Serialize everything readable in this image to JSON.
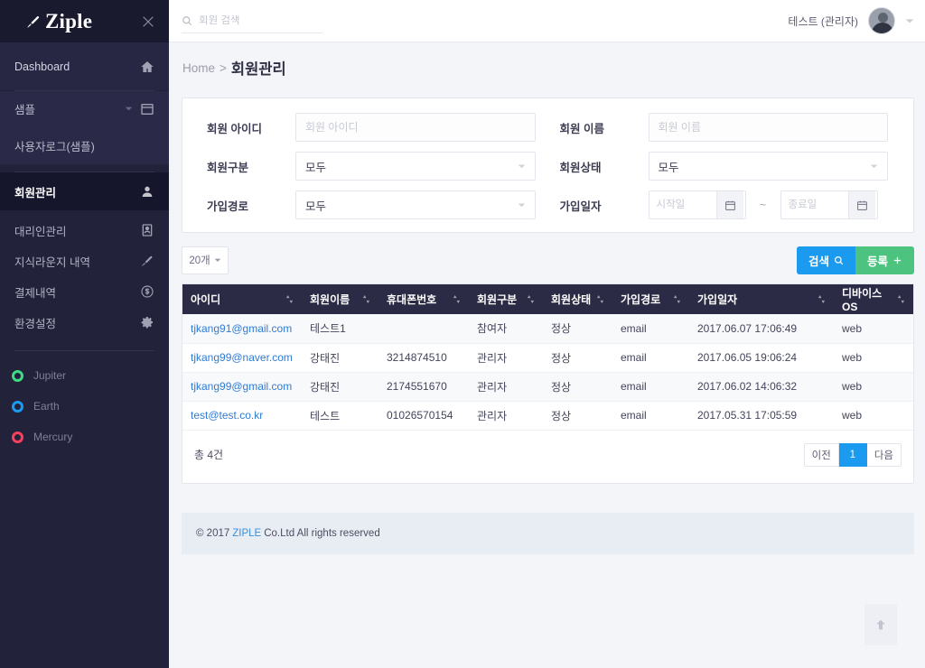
{
  "brand": {
    "name": "Ziple",
    "logo_icon": "pen-nib-icon",
    "close_icon": "close-icon"
  },
  "sidebar": {
    "items": [
      {
        "label": "Dashboard",
        "icon": "home-icon"
      },
      {
        "label": "샘플",
        "icon": "window-icon"
      },
      {
        "label": "사용자로그(샘플)",
        "icon": ""
      },
      {
        "label": "회원관리",
        "icon": "user-icon"
      },
      {
        "label": "대리인관리",
        "icon": "id-card-icon"
      },
      {
        "label": "지식라운지 내역",
        "icon": "pen-icon"
      },
      {
        "label": "결제내역",
        "icon": "dollar-icon"
      },
      {
        "label": "환경설정",
        "icon": "gear-icon"
      }
    ],
    "planets": [
      {
        "label": "Jupiter",
        "color": "#3ddc84"
      },
      {
        "label": "Earth",
        "color": "#1a9bf0"
      },
      {
        "label": "Mercury",
        "color": "#f9405c"
      }
    ]
  },
  "topbar": {
    "search_placeholder": "회원 검색",
    "search_value": "",
    "search_icon": "search-icon",
    "user_name": "테스트 (관리자)",
    "avatar_icon": "avatar",
    "caret_icon": "chevron-down-icon"
  },
  "breadcrumb": {
    "home": "Home",
    "separator": ">",
    "current": "회원관리"
  },
  "search_form": {
    "member_id": {
      "label": "회원 아이디",
      "placeholder": "회원 아이디",
      "value": ""
    },
    "member_name": {
      "label": "회원 이름",
      "placeholder": "회원 이름",
      "value": ""
    },
    "member_type": {
      "label": "회원구분",
      "value": "모두"
    },
    "member_state": {
      "label": "회원상태",
      "value": "모두"
    },
    "join_route": {
      "label": "가입경로",
      "value": "모두"
    },
    "join_date": {
      "label": "가입일자",
      "start_placeholder": "시작일",
      "start_value": "",
      "end_placeholder": "종료일",
      "end_value": "",
      "dash": "~",
      "calendar_icon": "calendar-icon"
    }
  },
  "toolbar": {
    "per_page": "20개",
    "search_label": "검색",
    "search_icon": "search-icon",
    "add_label": "등록",
    "add_icon": "plus-icon",
    "search_color": "#1a9bf0",
    "add_color": "#4cc47f"
  },
  "table": {
    "columns": [
      {
        "label": "아이디",
        "sort_icon": "sort-icon"
      },
      {
        "label": "회원이름",
        "sort_icon": "sort-icon"
      },
      {
        "label": "휴대폰번호",
        "sort_icon": "sort-icon"
      },
      {
        "label": "회원구분",
        "sort_icon": "sort-icon"
      },
      {
        "label": "회원상태",
        "sort_icon": "sort-icon"
      },
      {
        "label": "가입경로",
        "sort_icon": "sort-icon"
      },
      {
        "label": "가입일자",
        "sort_icon": "sort-icon"
      },
      {
        "label": "디바이스OS",
        "sort_icon": "sort-icon"
      }
    ],
    "rows": [
      {
        "id": "tjkang91@gmail.com",
        "name": "테스트1",
        "phone": "",
        "type": "참여자",
        "state": "정상",
        "route": "email",
        "joined": "2017.06.07 17:06:49",
        "os": "web"
      },
      {
        "id": "tjkang99@naver.com",
        "name": "강태진",
        "phone": "3214874510",
        "type": "관리자",
        "state": "정상",
        "route": "email",
        "joined": "2017.06.05 19:06:24",
        "os": "web"
      },
      {
        "id": "tjkang99@gmail.com",
        "name": "강태진",
        "phone": "2174551670",
        "type": "관리자",
        "state": "정상",
        "route": "email",
        "joined": "2017.06.02 14:06:32",
        "os": "web"
      },
      {
        "id": "test@test.co.kr",
        "name": "테스트",
        "phone": "01026570154",
        "type": "관리자",
        "state": "정상",
        "route": "email",
        "joined": "2017.05.31 17:05:59",
        "os": "web"
      }
    ],
    "total": "총 4건"
  },
  "pagination": {
    "prev": "이전",
    "pages": [
      "1"
    ],
    "next": "다음",
    "active": "1"
  },
  "footer": {
    "copyright_pre": "© 2017",
    "brand": "ZIPLE",
    "copyright_post": "Co.Ltd All rights reserved"
  },
  "scroll_top": {
    "icon": "arrow-up-icon"
  }
}
